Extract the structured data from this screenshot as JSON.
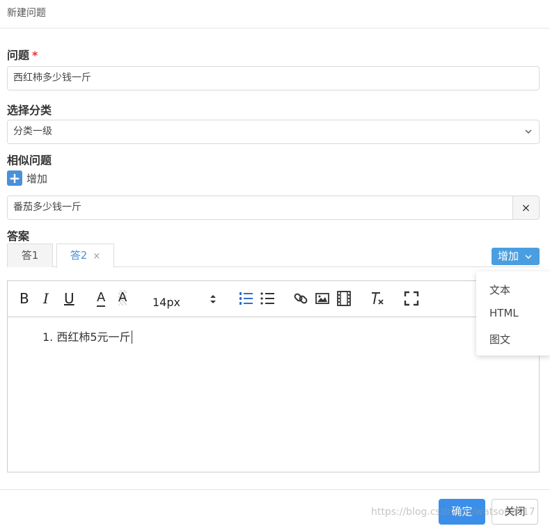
{
  "dialog": {
    "title": "新建问题"
  },
  "form": {
    "question_label": "问题",
    "required_mark": "*",
    "question_value": "西红柿多少钱一斤",
    "category_label": "选择分类",
    "category_value": "分类一级",
    "similar_label": "相似问题",
    "similar_add_label": "增加",
    "similar_items": [
      {
        "value": "番茄多少钱一斤",
        "delete_label": "×"
      }
    ],
    "answer_label": "答案"
  },
  "answer_tabs": [
    {
      "label": "答1",
      "active": false
    },
    {
      "label": "答2",
      "active": true,
      "close_label": "×"
    }
  ],
  "add_dropdown": {
    "label": "增加",
    "options": [
      "文本",
      "HTML",
      "图文"
    ]
  },
  "editor": {
    "toolbar": {
      "bold": "B",
      "italic": "I",
      "underline": "U",
      "font_color": "A",
      "bg_color": "A",
      "font_size": "14px"
    },
    "content_lines": [
      {
        "number": "1.",
        "text": "西红柿5元一斤"
      }
    ]
  },
  "footer": {
    "ok_label": "确定",
    "close_label": "关闭",
    "watermark": "https://blog.csdn.net/watson2017"
  },
  "colors": {
    "primary": "#3c8fe8",
    "active_tab": "#4a90d9",
    "required": "#e4393c"
  }
}
